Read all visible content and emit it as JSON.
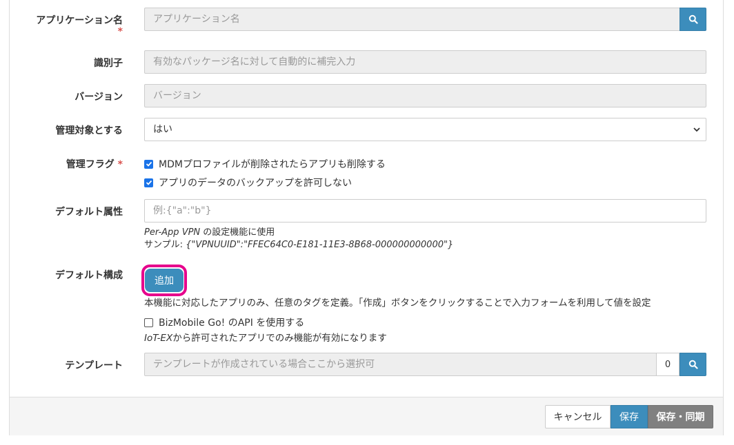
{
  "form": {
    "app_name": {
      "label": "アプリケーション名",
      "required_mark": "*",
      "placeholder": "アプリケーション名"
    },
    "identifier": {
      "label": "識別子",
      "placeholder": "有効なパッケージ名に対して自動的に補完入力"
    },
    "version": {
      "label": "バージョン",
      "placeholder": "バージョン"
    },
    "managed": {
      "label": "管理対象とする",
      "selected": "はい"
    },
    "flags": {
      "label": "管理フラグ",
      "required_mark": "*",
      "options": [
        {
          "label": "MDMプロファイルが削除されたらアプリも削除する",
          "checked": true
        },
        {
          "label": "アプリのデータのバックアップを許可しない",
          "checked": true
        }
      ]
    },
    "default_attr": {
      "label": "デフォルト属性",
      "placeholder": "例:{\"a\":\"b\"}",
      "help_line1_italic": "Per-App VPN",
      "help_line1_rest": " の設定機能に使用",
      "help_line2_prefix": "サンプル: ",
      "help_line2_sample": "{\"VPNUUID\":\"FFEC64C0-E181-11E3-8B68-000000000000\"}"
    },
    "default_config": {
      "label": "デフォルト構成",
      "add_button": "追加",
      "help": "本機能に対応したアプリのみ、任意のタグを定義。「作成」ボタンをクリックすることで入力フォームを利用して値を設定",
      "api_checkbox": {
        "label": "BizMobile Go! のAPI を使用する",
        "checked": false
      },
      "note_italic": "IoT-EX",
      "note_rest": "から許可されたアプリでのみ機能が有効になります"
    },
    "template": {
      "label": "テンプレート",
      "placeholder": "テンプレートが作成されている場合ここから選択可",
      "count": "0"
    }
  },
  "footer": {
    "cancel": "キャンセル",
    "save": "保存",
    "save_sync": "保存・同期"
  },
  "colors": {
    "primary": "#3c8dbc",
    "highlight": "#e6008c",
    "required": "#d9534f",
    "secondary": "#808080"
  }
}
